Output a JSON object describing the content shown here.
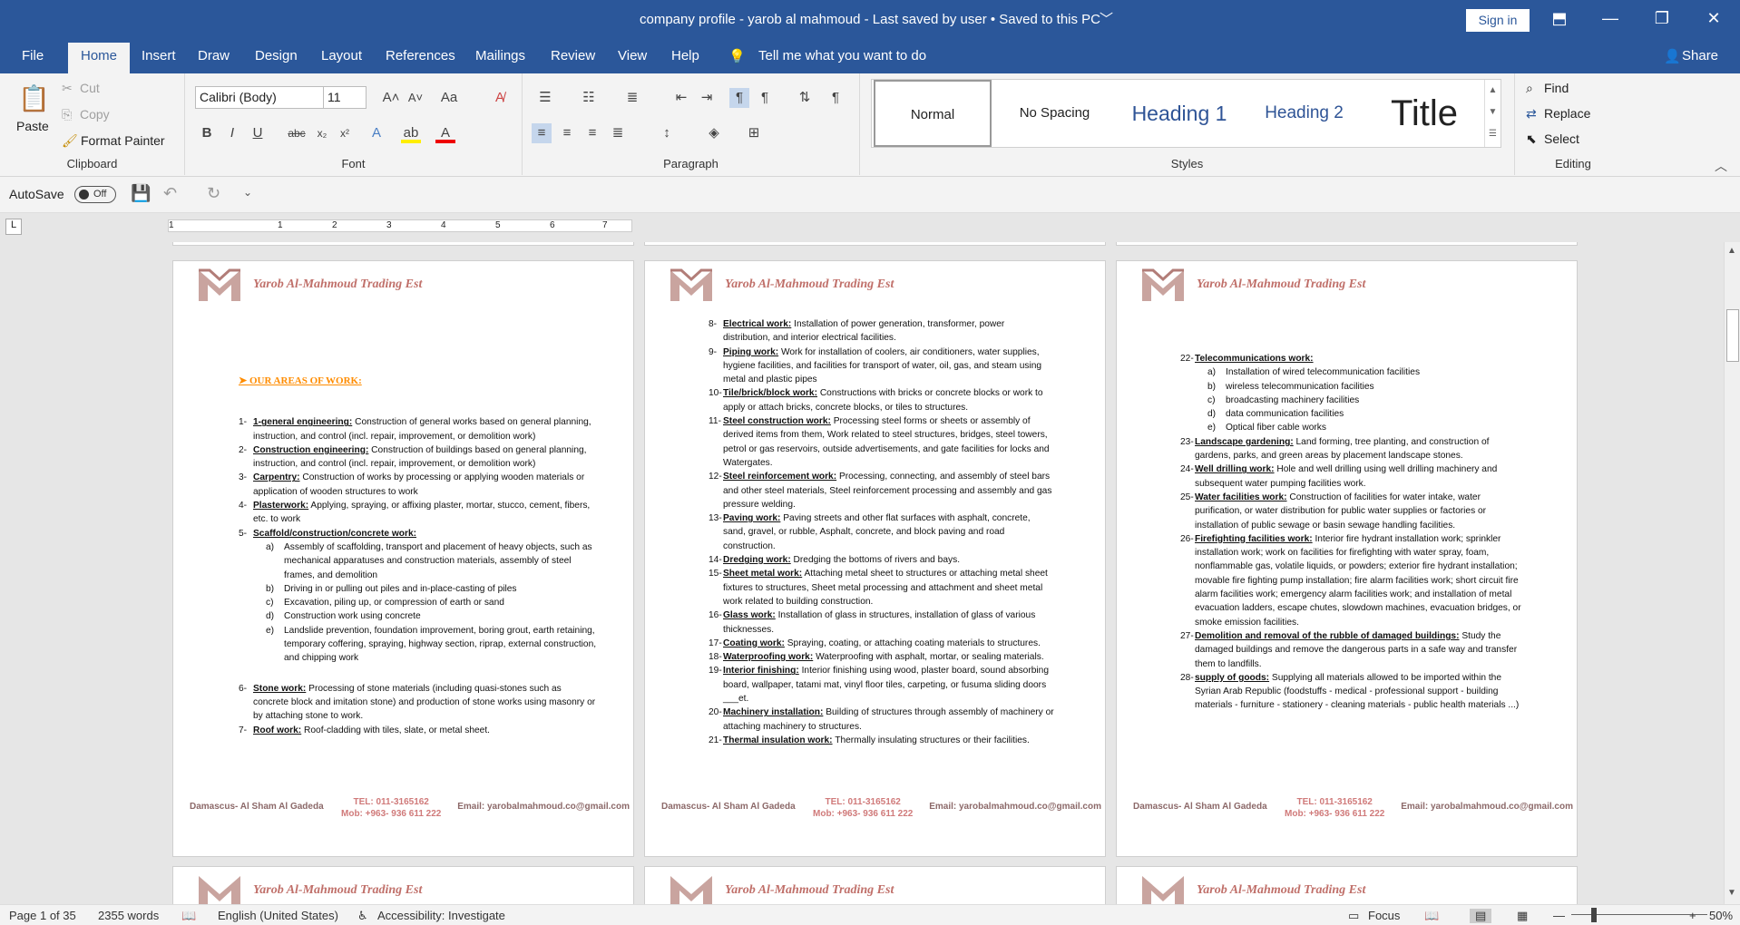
{
  "titlebar": {
    "title": "company profile - yarob al mahmoud  -  Last saved by user  •  Saved to this PC",
    "signin": "Sign in"
  },
  "tabs": [
    "File",
    "Home",
    "Insert",
    "Draw",
    "Design",
    "Layout",
    "References",
    "Mailings",
    "Review",
    "View",
    "Help"
  ],
  "tell_me": "Tell me what you want to do",
  "share": "Share",
  "clipboard": {
    "paste": "Paste",
    "cut": "Cut",
    "copy": "Copy",
    "format_painter": "Format Painter",
    "label": "Clipboard"
  },
  "font": {
    "name": "Calibri (Body)",
    "size": "11",
    "label": "Font"
  },
  "paragraph": {
    "label": "Paragraph"
  },
  "styles": {
    "items": [
      "Normal",
      "No Spacing",
      "Heading 1",
      "Heading 2",
      "Title"
    ],
    "label": "Styles"
  },
  "editing": {
    "find": "Find",
    "replace": "Replace",
    "select": "Select",
    "label": "Editing"
  },
  "qat": {
    "autosave": "AutoSave",
    "toggle": "Off"
  },
  "ruler": [
    "1",
    "1",
    "2",
    "3",
    "4",
    "5",
    "6",
    "7"
  ],
  "company": "Yarob Al-Mahmoud Trading Est",
  "footer": {
    "address": "Damascus- Al Sham Al Gadeda",
    "tel": "TEL: 011-3165162",
    "mob": "Mob: +963- 936 611 222",
    "email": "Email: yarobalmahmoud.co@gmail.com"
  },
  "page1": {
    "section": "OUR AREAS OF WORK:",
    "items": [
      {
        "n": "1-",
        "t": "1-general engineering:",
        "d": " Construction of general works based on general planning, instruction, and control (incl. repair, improvement, or demolition work)"
      },
      {
        "n": "2-",
        "t": "Construction engineering:",
        "d": " Construction of buildings based on general planning, instruction, and control (incl. repair, improvement, or demolition work)"
      },
      {
        "n": "3-",
        "t": "Carpentry:",
        "d": " Construction of works by processing or applying wooden materials or application of wooden structures to work"
      },
      {
        "n": "4-",
        "t": "Plasterwork:",
        "d": " Applying, spraying, or affixing plaster, mortar, stucco, cement, fibers, etc. to work"
      },
      {
        "n": "5-",
        "t": "Scaffold/construction/concrete work:",
        "d": ""
      }
    ],
    "sub5": [
      {
        "n": "a)",
        "d": "Assembly of scaffolding, transport and placement of heavy objects, such as mechanical apparatuses and construction materials, assembly of steel frames, and demolition"
      },
      {
        "n": "b)",
        "d": "Driving in or pulling out piles and in-place-casting of piles"
      },
      {
        "n": "c)",
        "d": "Excavation, piling up, or compression of earth or sand"
      },
      {
        "n": "d)",
        "d": "Construction work using concrete"
      },
      {
        "n": "e)",
        "d": "Landslide prevention, foundation improvement, boring grout, earth retaining, temporary coffering, spraying, highway section, riprap, external construction, and chipping work"
      }
    ],
    "items2": [
      {
        "n": "6-",
        "t": "Stone work:",
        "d": " Processing of stone materials (including quasi-stones such as concrete block and imitation stone) and production of stone works using masonry or by attaching stone to work."
      },
      {
        "n": "7-",
        "t": "Roof work:",
        "d": " Roof-cladding with tiles, slate, or metal sheet."
      }
    ]
  },
  "page2": {
    "items": [
      {
        "n": "8-",
        "t": "Electrical work:",
        "d": " Installation of power generation, transformer, power distribution, and interior electrical facilities."
      },
      {
        "n": "9-",
        "t": "Piping work:",
        "d": " Work for installation of coolers, air conditioners, water supplies, hygiene facilities, and facilities for transport of water, oil, gas, and steam using metal and plastic pipes"
      },
      {
        "n": "10-",
        "t": "Tile/brick/block work:",
        "d": " Constructions with bricks or concrete blocks or work to apply or attach bricks, concrete blocks, or tiles to structures."
      },
      {
        "n": "11-",
        "t": "Steel construction work:",
        "d": " Processing steel forms or sheets or assembly of derived items from them, Work related to steel structures, bridges, steel towers, petrol or gas reservoirs, outside advertisements, and gate facilities for locks and Watergates."
      },
      {
        "n": "12-",
        "t": "Steel reinforcement work:",
        "d": " Processing, connecting, and assembly of steel bars and other steel materials, Steel reinforcement processing and assembly and gas pressure welding."
      },
      {
        "n": "13-",
        "t": "Paving work:",
        "d": " Paving streets and other flat surfaces with asphalt, concrete, sand, gravel, or rubble, Asphalt, concrete, and block paving and road construction."
      },
      {
        "n": "14-",
        "t": "Dredging work:",
        "d": " Dredging the bottoms of rivers and bays."
      },
      {
        "n": "15-",
        "t": "Sheet metal work:",
        "d": "  Attaching metal sheet to structures or attaching metal sheet fixtures to structures, Sheet metal processing and attachment and sheet metal work related to building construction."
      },
      {
        "n": "16-",
        "t": "Glass work:",
        "d": " Installation of glass in structures, installation of glass of various thicknesses."
      },
      {
        "n": "17-",
        "t": "Coating work:",
        "d": " Spraying, coating, or attaching coating materials to structures."
      },
      {
        "n": "18-",
        "t": "Waterproofing work:",
        "d": " Waterproofing with asphalt, mortar, or sealing materials."
      },
      {
        "n": "19-",
        "t": "Interior finishing:",
        "d": " Interior finishing using wood, plaster board, sound absorbing board, wallpaper, tatami mat, vinyl floor tiles, carpeting, or fusuma sliding doors ___et."
      },
      {
        "n": "20-",
        "t": "Machinery installation:",
        "d": " Building of structures through assembly of machinery or attaching machinery to structures."
      },
      {
        "n": "21-",
        "t": "Thermal insulation work:",
        "d": " Thermally insulating structures or their facilities."
      }
    ]
  },
  "page3": {
    "item22": {
      "n": "22-",
      "t": "Telecommunications work:",
      "d": ""
    },
    "sub22": [
      {
        "n": "a)",
        "d": "Installation of wired telecommunication facilities"
      },
      {
        "n": "b)",
        "d": "wireless telecommunication facilities"
      },
      {
        "n": "c)",
        "d": "broadcasting machinery facilities"
      },
      {
        "n": "d)",
        "d": "data communication facilities"
      },
      {
        "n": "e)",
        "d": "Optical fiber cable works"
      }
    ],
    "items": [
      {
        "n": "23-",
        "t": "Landscape gardening:",
        "d": " Land forming, tree planting, and construction of gardens, parks, and green areas by placement landscape stones."
      },
      {
        "n": "24-",
        "t": "Well drilling work:",
        "d": " Hole and well drilling using well drilling machinery and subsequent water pumping facilities work."
      },
      {
        "n": "25-",
        "t": "Water facilities work:",
        "d": " Construction of facilities for water intake, water purification, or water distribution for public water supplies or factories or installation of public sewage or basin sewage handling facilities."
      },
      {
        "n": "26-",
        "t": "Firefighting facilities work:",
        "d": " Interior fire hydrant installation work; sprinkler installation work; work on facilities for firefighting with water spray, foam, nonflammable gas, volatile liquids, or powders; exterior fire hydrant installation; movable fire fighting pump installation; fire alarm facilities work; short circuit fire alarm facilities work; emergency alarm facilities work; and installation of metal evacuation ladders, escape chutes, slowdown machines, evacuation bridges, or smoke emission facilities."
      },
      {
        "n": "27-",
        "t": "Demolition and removal of the rubble of damaged buildings:",
        "d": " Study the damaged buildings and remove the dangerous parts in a safe way and transfer them to landfills."
      },
      {
        "n": "28-",
        "t": "supply of goods:",
        "d": " Supplying all materials allowed to be imported within the Syrian Arab Republic (foodstuffs - medical - professional support - building materials - furniture - stationery - cleaning materials - public health materials ...)"
      }
    ]
  },
  "status": {
    "page": "Page 1 of 35",
    "words": "2355 words",
    "language": "English (United States)",
    "accessibility": "Accessibility: Investigate",
    "focus": "Focus",
    "zoom": "50%"
  },
  "colors": {
    "brand": "#2b579a",
    "company": "#c0706a",
    "section": "#ff8c00"
  }
}
